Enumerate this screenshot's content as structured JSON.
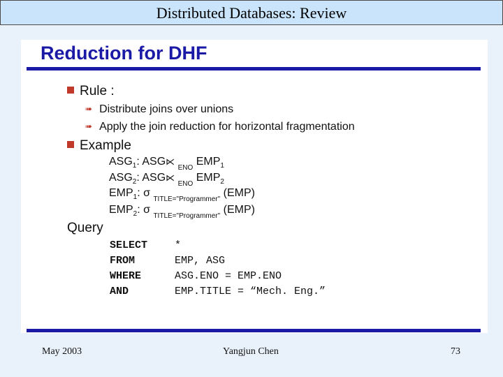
{
  "header": {
    "title": "Distributed Databases: Review"
  },
  "slide": {
    "heading": "Reduction for DHF",
    "rule_label": "Rule :",
    "rule_items": [
      "Distribute joins over unions",
      "Apply the join reduction for horizontal fragmentation"
    ],
    "example_label": "Example",
    "example_lines": [
      {
        "lhs": "ASG",
        "lhs_sub": "1",
        "op": "ASG",
        "join": "⋉",
        "attr": "ENO",
        "rhs": "EMP",
        "rhs_sub": "1"
      },
      {
        "lhs": "ASG",
        "lhs_sub": "2",
        "op": "ASG",
        "join": "⋉",
        "attr": "ENO",
        "rhs": "EMP",
        "rhs_sub": "2"
      },
      {
        "lhs": "EMP",
        "lhs_sub": "1",
        "sigma": "σ",
        "cond": "TITLE=\"Programmer\"",
        "arg": "(EMP)"
      },
      {
        "lhs": "EMP",
        "lhs_sub": "2",
        "sigma": "σ",
        "cond": "TITLE=\"Programmer\"",
        "arg": "(EMP)"
      }
    ],
    "query_label": "Query",
    "query": [
      {
        "kw": "SELECT",
        "val": "*"
      },
      {
        "kw": "FROM",
        "val": "EMP, ASG"
      },
      {
        "kw": "WHERE",
        "val": "ASG.ENO = EMP.ENO"
      },
      {
        "kw": "AND",
        "val": "EMP.TITLE = “Mech. Eng.”"
      }
    ]
  },
  "footer": {
    "date": "May 2003",
    "author": "Yangjun Chen",
    "page": "73"
  },
  "colors": {
    "accent": "#1a1aa6",
    "bullet": "#c0392b",
    "titlebar": "#c9e4fb",
    "background": "#e9f1fb"
  }
}
